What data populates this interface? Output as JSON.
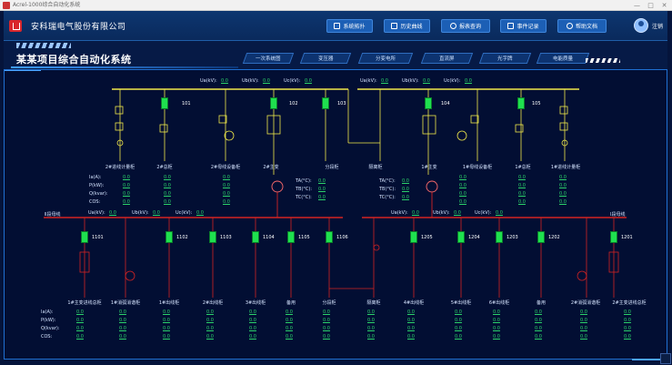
{
  "window": {
    "title": "Acrel-1000综合自动化系统",
    "controls": [
      "—",
      "□",
      "✕"
    ]
  },
  "header": {
    "company": "安科瑞电气股份有限公司",
    "nav": [
      {
        "label": "系统拓扑",
        "icon": "topology-icon"
      },
      {
        "label": "历史曲线",
        "icon": "chart-icon"
      },
      {
        "label": "报表查询",
        "icon": "search-icon"
      },
      {
        "label": "事件记录",
        "icon": "document-icon"
      },
      {
        "label": "帮助文档",
        "icon": "help-icon"
      }
    ],
    "user": "注销"
  },
  "page_title": "某某项目综合自动化系统",
  "tabs": [
    "一次系统图",
    "变压器",
    "分变电所",
    "直流屏",
    "光字牌",
    "电能质量"
  ],
  "hv": {
    "left_voltages": [
      {
        "label": "Ua(kV):",
        "value": "0.0"
      },
      {
        "label": "Ub(kV):",
        "value": "0.0"
      },
      {
        "label": "Uc(kV):",
        "value": "0.0"
      }
    ],
    "right_voltages": [
      {
        "label": "Ua(kV):",
        "value": "0.0"
      },
      {
        "label": "Ub(kV):",
        "value": "0.0"
      },
      {
        "label": "Uc(kV):",
        "value": "0.0"
      }
    ],
    "feeders": [
      "2#进线计量柜",
      "2#总柜",
      "2#母线设备柜",
      "2#主变",
      "分段柜",
      "隔离柜",
      "1#主变",
      "1#母线设备柜",
      "1#总柜",
      "1#进线计量柜"
    ],
    "breakers": [
      "101",
      "102",
      "103",
      "104",
      "105"
    ],
    "meter_labels": [
      "Ia(A):",
      "P(kW):",
      "Q(kvar):",
      "COS:"
    ],
    "meter_values": [
      "0.0",
      "0.0",
      "0.0",
      "0.0"
    ],
    "temps_left": [
      {
        "label": "TA(°C):",
        "value": "0.0"
      },
      {
        "label": "TB(°C):",
        "value": "0.0"
      },
      {
        "label": "TC(°C):",
        "value": "0.0"
      }
    ],
    "temps_right": [
      {
        "label": "TA(°C):",
        "value": "0.0"
      },
      {
        "label": "TB(°C):",
        "value": "0.0"
      },
      {
        "label": "TC(°C):",
        "value": "0.0"
      }
    ]
  },
  "lv": {
    "left_bus": "Ⅱ段母线",
    "right_bus": "Ⅰ段母线",
    "left_voltages": [
      {
        "label": "Ua(kV):",
        "value": "0.0"
      },
      {
        "label": "Ub(kV):",
        "value": "0.0"
      },
      {
        "label": "Uc(kV):",
        "value": "0.0"
      }
    ],
    "right_voltages": [
      {
        "label": "Ua(kV):",
        "value": "0.0"
      },
      {
        "label": "Ub(kV):",
        "value": "0.0"
      },
      {
        "label": "Uc(kV):",
        "value": "0.0"
      }
    ],
    "breakers": [
      "1101",
      "1102",
      "1103",
      "1104",
      "1105",
      "1106",
      "1205",
      "1204",
      "1203",
      "1202",
      "1201"
    ],
    "feeders": [
      "1#主变进线总柜",
      "1#消弧消谐柜",
      "1#出线柜",
      "2#出线柜",
      "3#出线柜",
      "备用",
      "分段柜",
      "隔离柜",
      "4#出线柜",
      "5#出线柜",
      "6#出线柜",
      "备用",
      "2#消弧消谐柜",
      "2#主变进线总柜"
    ],
    "meter_labels": [
      "Ia(A):",
      "P(kW):",
      "Q(kvar):",
      "COS:"
    ],
    "meter_values": [
      "0.0",
      "0.0",
      "0.0",
      "0.0"
    ]
  },
  "colors": {
    "bus_red": "#d42323",
    "bus_yellow": "#f2e94a",
    "closed_green": "#1fe04f",
    "value_green": "#2bd26a",
    "accent_blue": "#1c5fb5"
  }
}
